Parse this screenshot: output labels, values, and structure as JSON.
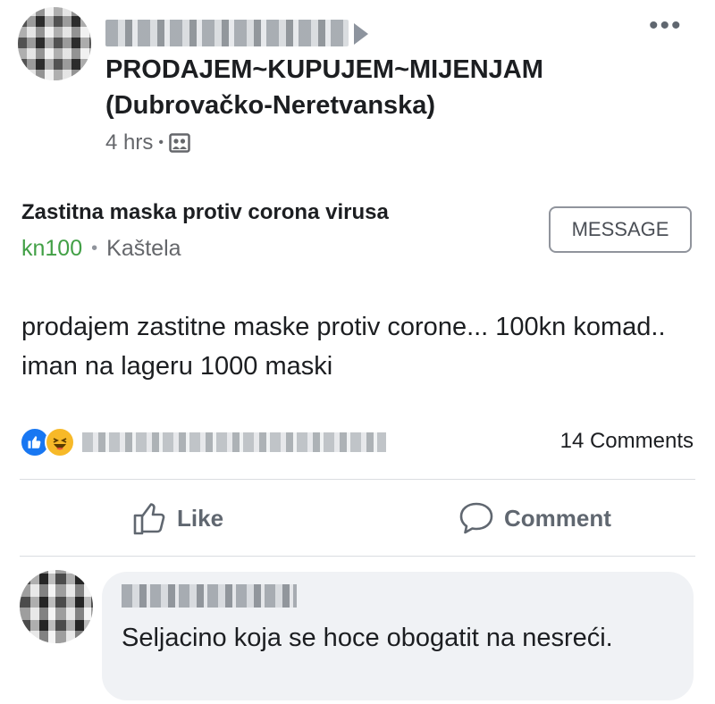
{
  "post": {
    "group_name": "PRODAJEM~KUPUJEM~MIJENJAM (Dubrovačko-Neretvanska)",
    "time": "4 hrs",
    "separator": "•",
    "privacy_icon": "group-photo-icon",
    "more_icon": "more-options-icon",
    "more_glyph": "•••"
  },
  "listing": {
    "title": "Zastitna maska protiv corona virusa",
    "price": "kn100",
    "separator": "•",
    "location": "Kaštela",
    "message_button": "MESSAGE",
    "price_color": "#42a046"
  },
  "body": {
    "text": "prodajem zastitne maske protiv corone... 100kn komad.. iman na lageru 1000 maski"
  },
  "reactions": {
    "icons": [
      "like-reaction-icon",
      "haha-reaction-icon"
    ],
    "comments_count": "14 Comments"
  },
  "actions": {
    "like_label": "Like",
    "comment_label": "Comment"
  },
  "comment": {
    "text": "Seljacino koja se hoce obogatit na nesreći."
  },
  "colors": {
    "like_blue": "#1877f2",
    "haha_yellow": "#f7b928",
    "muted": "#65676b"
  }
}
